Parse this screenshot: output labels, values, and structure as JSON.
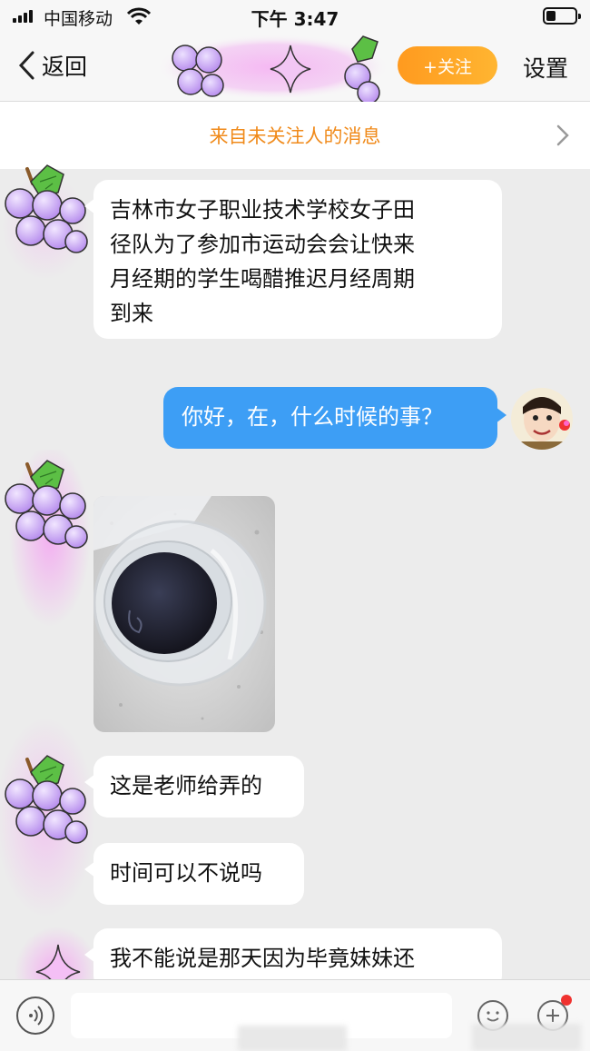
{
  "status_bar": {
    "carrier": "中国移动",
    "time": "下午 3:47"
  },
  "nav": {
    "back_label": "返回",
    "follow_label": "+关注",
    "settings_label": "设置"
  },
  "notice": {
    "text": "来自未关注人的消息"
  },
  "messages": [
    {
      "sender": "them",
      "type": "text",
      "lines": [
        "吉林市女子职业技术学校女子田",
        "径队为了参加市运动会会让快来",
        "月经期的学生喝醋推迟月经周期",
        "到来"
      ]
    },
    {
      "sender": "me",
      "type": "text",
      "text": "你好，在，什么时候的事？"
    },
    {
      "sender": "them",
      "type": "image",
      "subject": "cup-of-dark-liquid-photo"
    },
    {
      "sender": "them",
      "type": "text",
      "text": "这是老师给弄的"
    },
    {
      "sender": "them",
      "type": "text",
      "text": "时间可以不说吗"
    },
    {
      "sender": "them",
      "type": "text",
      "text": "我不能说是那天因为毕竟妹妹还"
    }
  ],
  "colors": {
    "accent_orange": "#ff9a1f",
    "notice_orange": "#f08a1a",
    "outgoing_bubble": "#3d9ef5",
    "background": "#ececec",
    "grape_purple": "#c9a6f2",
    "leaf_green": "#4cae3c",
    "glow_pink": "#f2a3f0"
  },
  "icons": {
    "back": "chevron-left-icon",
    "notice_arrow": "chevron-right-icon",
    "voice": "voice-icon",
    "emoji": "emoji-icon",
    "plus": "plus-icon"
  }
}
